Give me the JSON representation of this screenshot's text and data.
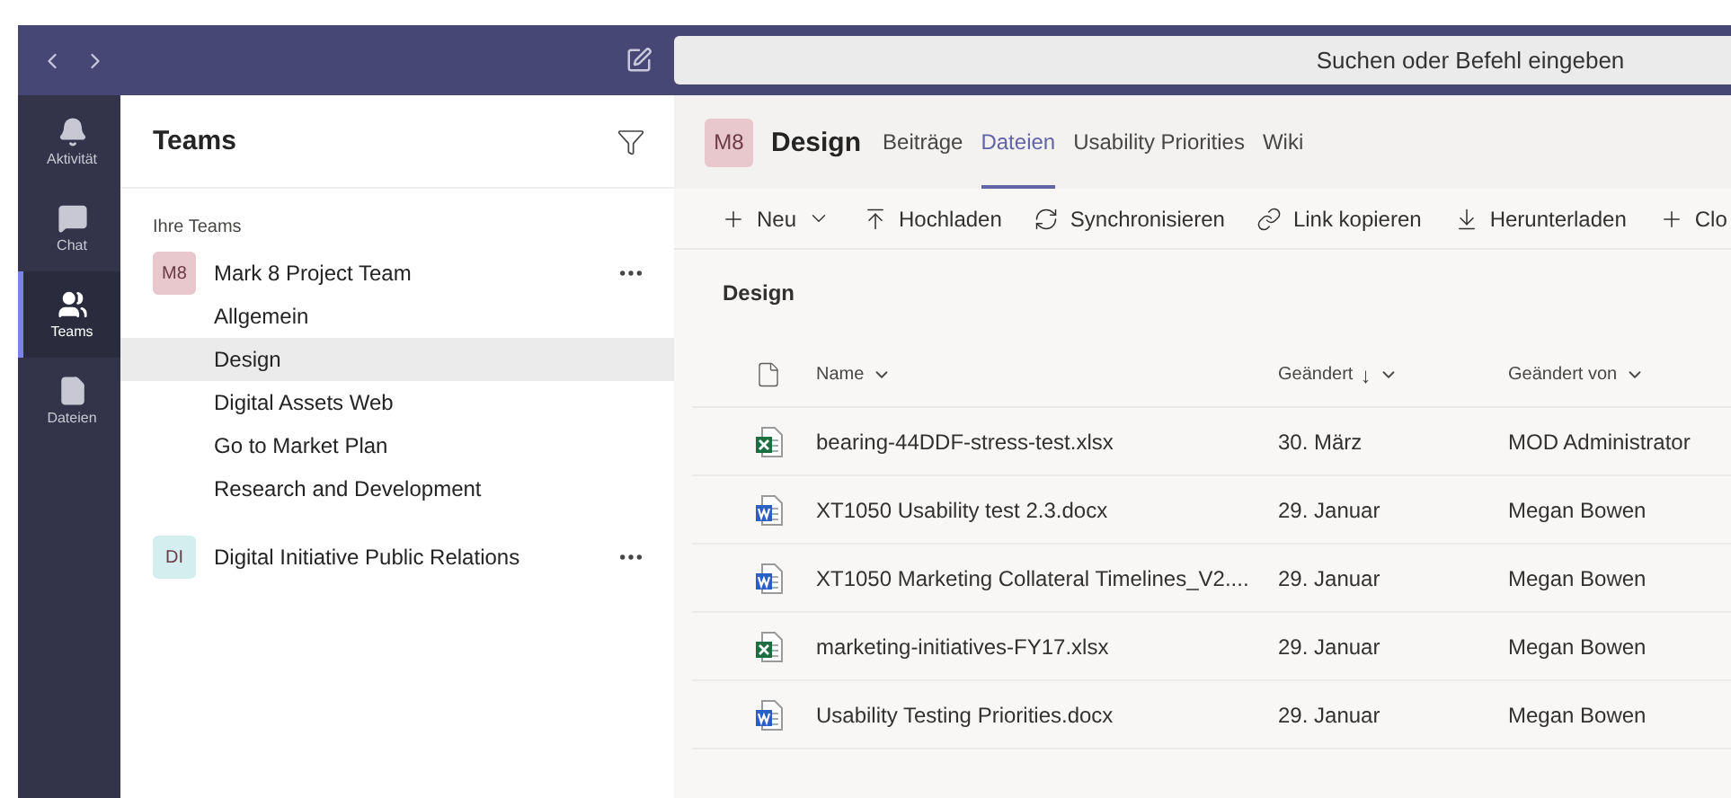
{
  "search": {
    "placeholder": "Suchen oder Befehl eingeben"
  },
  "rail": [
    {
      "kind": "activity",
      "label": "Aktivität",
      "selected": false
    },
    {
      "kind": "chat",
      "label": "Chat",
      "selected": false
    },
    {
      "kind": "teams",
      "label": "Teams",
      "selected": true
    },
    {
      "kind": "files",
      "label": "Dateien",
      "selected": false
    }
  ],
  "sidebar": {
    "title": "Teams",
    "section": "Ihre Teams",
    "teams": [
      {
        "initials": "M8",
        "name": "Mark 8 Project Team",
        "color": "#e8c8cd",
        "channels": [
          {
            "name": "Allgemein",
            "selected": false
          },
          {
            "name": "Design",
            "selected": true
          },
          {
            "name": "Digital Assets Web",
            "selected": false
          },
          {
            "name": "Go to Market Plan",
            "selected": false
          },
          {
            "name": "Research and Development",
            "selected": false
          }
        ]
      },
      {
        "initials": "DI",
        "name": "Digital Initiative Public Relations",
        "color": "#d4eef0"
      }
    ]
  },
  "header": {
    "initials": "M8",
    "title": "Design",
    "tabs": [
      {
        "label": "Beiträge",
        "selected": false
      },
      {
        "label": "Dateien",
        "selected": true
      },
      {
        "label": "Usability Priorities",
        "selected": false
      },
      {
        "label": "Wiki",
        "selected": false
      }
    ]
  },
  "toolbar": [
    {
      "kind": "new",
      "label": "Neu"
    },
    {
      "kind": "upload",
      "label": "Hochladen"
    },
    {
      "kind": "sync",
      "label": "Synchronisieren"
    },
    {
      "kind": "link",
      "label": "Link kopieren"
    },
    {
      "kind": "download",
      "label": "Herunterladen"
    },
    {
      "kind": "add",
      "label": "Clo"
    }
  ],
  "breadcrumb": "Design",
  "columns": [
    {
      "label": "Name"
    },
    {
      "label": "Geändert",
      "sort": "↓"
    },
    {
      "label": "Geändert von"
    }
  ],
  "files": [
    {
      "kind": "excel",
      "name": "bearing-44DDF-stress-test.xlsx",
      "modified": "30. März",
      "modified_by": "MOD Administrator"
    },
    {
      "kind": "word",
      "name": "XT1050 Usability test 2.3.docx",
      "modified": "29. Januar",
      "modified_by": "Megan Bowen"
    },
    {
      "kind": "word",
      "name": "XT1050 Marketing Collateral Timelines_V2....",
      "modified": "29. Januar",
      "modified_by": "Megan Bowen"
    },
    {
      "kind": "excel",
      "name": "marketing-initiatives-FY17.xlsx",
      "modified": "29. Januar",
      "modified_by": "Megan Bowen"
    },
    {
      "kind": "word",
      "name": "Usability Testing Priorities.docx",
      "modified": "29. Januar",
      "modified_by": "Megan Bowen"
    }
  ]
}
